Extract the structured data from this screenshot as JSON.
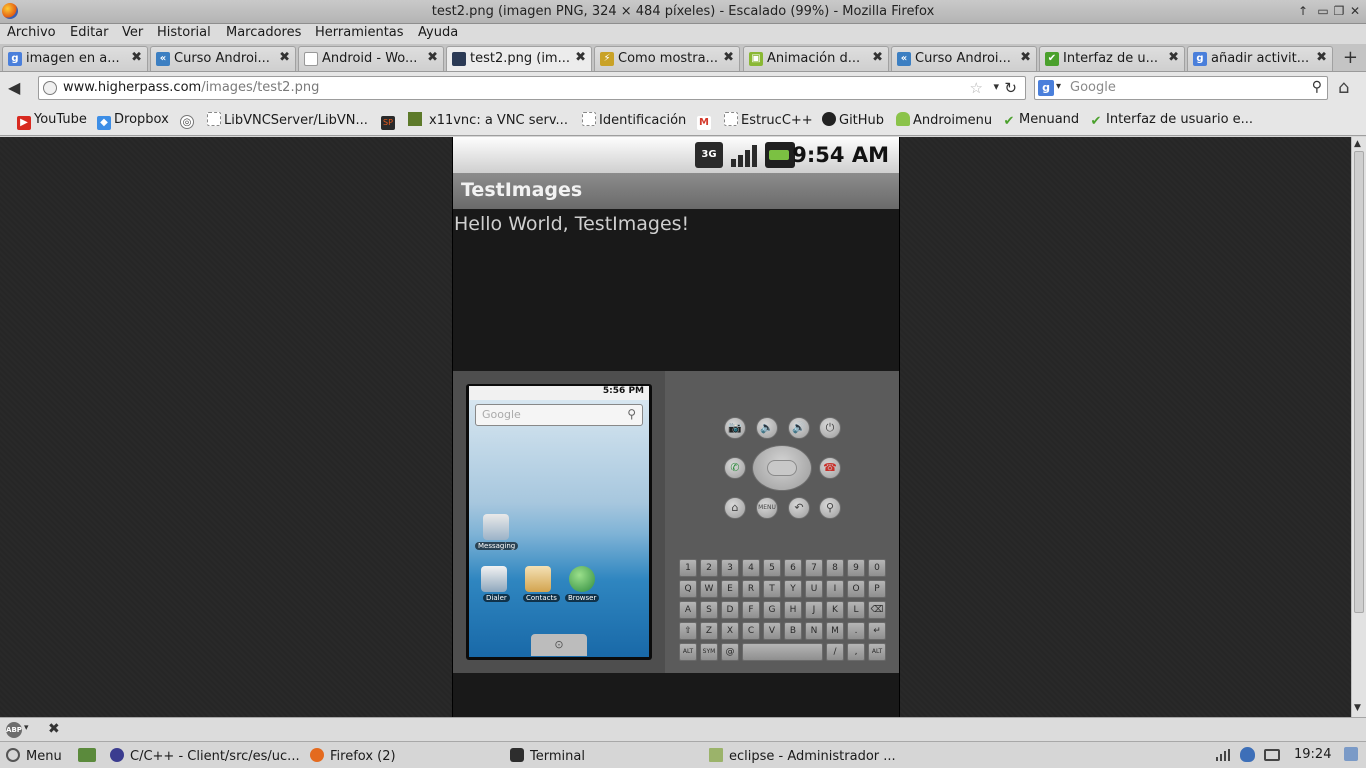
{
  "window": {
    "title": "test2.png (imagen PNG, 324 × 484 píxeles) - Escalado (99%) - Mozilla Firefox",
    "btn_up": "↑",
    "btn_min": "▭",
    "btn_max": "❐",
    "btn_close": "✕"
  },
  "menu": [
    "Archivo",
    "Editar",
    "Ver",
    "Historial",
    "Marcadores",
    "Herramientas",
    "Ayuda"
  ],
  "tabs": [
    {
      "label": "imagen en a...",
      "icon": "google-icon",
      "color": "#4a7fdb",
      "glyph": "g"
    },
    {
      "label": "Curso Androi...",
      "icon": "sgoliver-icon",
      "color": "#3c7fc2",
      "glyph": "«"
    },
    {
      "label": "Android - Wo...",
      "icon": "blank-page-icon",
      "color": "#ffffff",
      "glyph": ""
    },
    {
      "label": "test2.png (im...",
      "icon": "image-icon",
      "color": "#2b3a55",
      "glyph": ""
    },
    {
      "label": "Como mostra...",
      "icon": "stackoverflow-icon",
      "color": "#c9a227",
      "glyph": "⚡"
    },
    {
      "label": "Animación d...",
      "icon": "android-dev-icon",
      "color": "#8ab834",
      "glyph": "▣"
    },
    {
      "label": "Curso Androi...",
      "icon": "sgoliver-icon",
      "color": "#3c7fc2",
      "glyph": "«"
    },
    {
      "label": "Interfaz de u...",
      "icon": "check-icon",
      "color": "#4aa02c",
      "glyph": "✔"
    },
    {
      "label": "añadir activit...",
      "icon": "google-icon",
      "color": "#4a7fdb",
      "glyph": "g"
    }
  ],
  "tab_close": "✖",
  "new_tab": "+",
  "nav": {
    "back": "◀",
    "url_host": "www.higherpass.com",
    "url_path": "/images/test2.png",
    "star": "☆",
    "dropdown": "▾",
    "reload": "↻",
    "search_engine": "g",
    "search_caret": "▾",
    "search_placeholder": "Google",
    "search_glass": "⚲",
    "home": "⌂"
  },
  "bookmarks": [
    {
      "label": "YouTube",
      "icon": "youtube-icon",
      "color": "#d82a20",
      "glyph": "▶"
    },
    {
      "label": "Dropbox",
      "icon": "dropbox-icon",
      "color": "#3d8ee6",
      "glyph": "◆"
    },
    {
      "label": "",
      "icon": "settings-icon",
      "color": "#555555",
      "glyph": "◎"
    },
    {
      "label": "LibVNCServer/LibVN...",
      "icon": "blank-page-icon",
      "color": "#ffffff",
      "glyph": ""
    },
    {
      "label": "",
      "icon": "sp-icon",
      "color": "#c23b10",
      "glyph": "SP"
    },
    {
      "label": "x11vnc: a VNC serv...",
      "icon": "x11vnc-icon",
      "color": "#5d7a2a",
      "glyph": ""
    },
    {
      "label": "Identificación",
      "icon": "blank-page-icon",
      "color": "#ffffff",
      "glyph": ""
    },
    {
      "label": "",
      "icon": "gmail-icon",
      "color": "#ffffff",
      "glyph": "M"
    },
    {
      "label": "EstrucC++",
      "icon": "blank-page-icon",
      "color": "#ffffff",
      "glyph": ""
    },
    {
      "label": "GitHub",
      "icon": "github-icon",
      "color": "#222222",
      "glyph": "●"
    },
    {
      "label": "Androimenu",
      "icon": "android-icon",
      "color": "#8bc34a",
      "glyph": "▲"
    },
    {
      "label": "Menuand",
      "icon": "check-icon",
      "color": "#4aa02c",
      "glyph": "✔"
    },
    {
      "label": "Interfaz de usuario e...",
      "icon": "check-icon",
      "color": "#4aa02c",
      "glyph": "✔"
    }
  ],
  "image": {
    "status_icon_3g": "3G",
    "status_time": "9:54 AM",
    "app_title": "TestImages",
    "hello_text": "Hello World, TestImages!",
    "phone": {
      "time": "5:56 PM",
      "search_placeholder": "Google",
      "search_glass": "⚲",
      "icons": [
        "Messaging",
        "Dialer",
        "Contacts",
        "Browser"
      ],
      "drawer_glyph": "⊙"
    },
    "controls": [
      "📷",
      "🔈",
      "🔊",
      "⏻",
      "✆",
      "☎",
      "⌂",
      "MENU",
      "↶",
      "⚲"
    ],
    "keyboard": [
      [
        "1",
        "2",
        "3",
        "4",
        "5",
        "6",
        "7",
        "8",
        "9",
        "0"
      ],
      [
        "Q",
        "W",
        "E",
        "R",
        "T",
        "Y",
        "U",
        "I",
        "O",
        "P"
      ],
      [
        "A",
        "S",
        "D",
        "F",
        "G",
        "H",
        "J",
        "K",
        "L",
        "⌫"
      ],
      [
        "⇧",
        "Z",
        "X",
        "C",
        "V",
        "B",
        "N",
        "M",
        ".",
        "↵"
      ],
      [
        "ALT",
        "SYM",
        "@",
        "",
        "",
        "",
        "",
        "/",
        ",",
        "ALT"
      ]
    ]
  },
  "scroll": {
    "up": "▲",
    "down": "▼"
  },
  "addon_bar": {
    "abp": "ABP",
    "dropdown": "▾",
    "close": "✖"
  },
  "taskbar": {
    "menu_label": "Menu",
    "items": [
      {
        "label": "",
        "icon": "show-desktop-icon",
        "color": "#5b8a3c"
      },
      {
        "label": "C/C++ - Client/src/es/uc...",
        "icon": "eclipse-icon",
        "color": "#3b3c8f"
      },
      {
        "label": "Firefox (2)",
        "icon": "firefox-icon",
        "color": "#e46a1e"
      },
      {
        "label": "Terminal",
        "icon": "terminal-icon",
        "color": "#2d2d2d"
      },
      {
        "label": "eclipse - Administrador ...",
        "icon": "folder-icon",
        "color": "#9bb36a"
      }
    ],
    "clock": "19:24"
  }
}
